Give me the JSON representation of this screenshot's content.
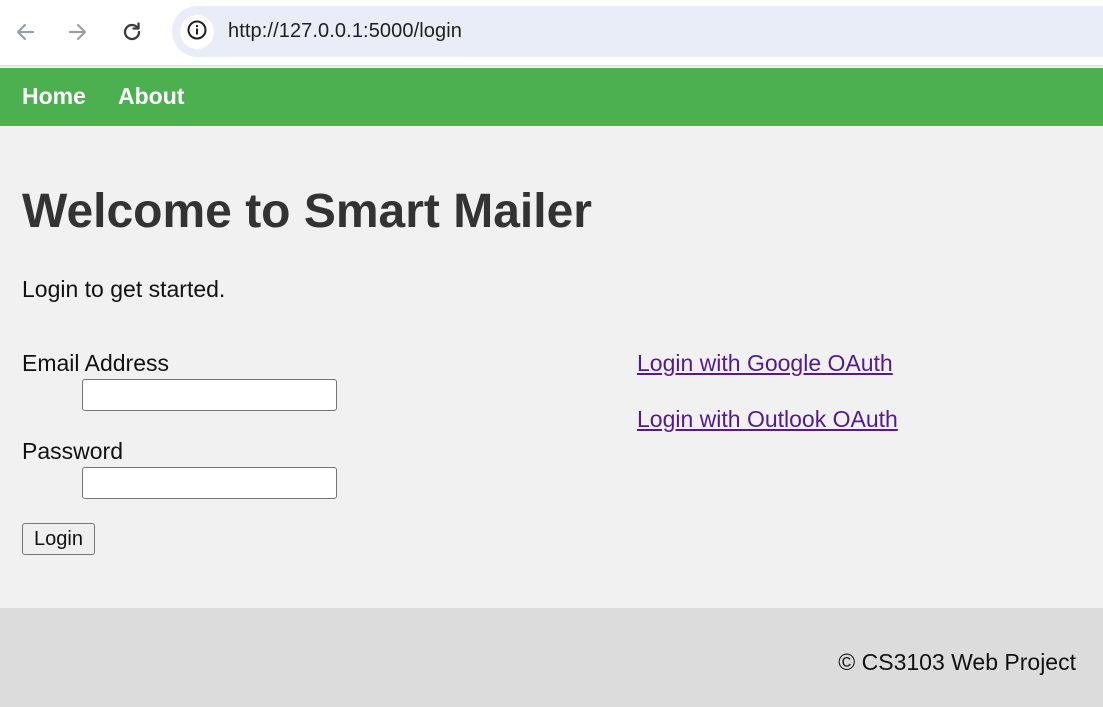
{
  "browser": {
    "url": "http://127.0.0.1:5000/login",
    "icons": [
      "back-arrow-icon",
      "forward-arrow-icon",
      "reload-icon",
      "site-info-icon"
    ]
  },
  "nav": {
    "home_label": "Home",
    "about_label": "About"
  },
  "main": {
    "title": "Welcome to Smart Mailer",
    "subtitle": "Login to get started.",
    "form": {
      "email_label": "Email Address",
      "email_value": "",
      "password_label": "Password",
      "password_value": "",
      "login_button": "Login"
    },
    "oauth": {
      "google_label": "Login with Google OAuth",
      "outlook_label": "Login with Outlook OAuth"
    }
  },
  "footer": {
    "text": "© CS3103 Web Project"
  },
  "colors": {
    "nav_bg": "#4caf50",
    "page_bg": "#f1f1f1",
    "footer_bg": "#dcdcdc",
    "visited_link": "#551a8b",
    "title_text": "#333333"
  }
}
